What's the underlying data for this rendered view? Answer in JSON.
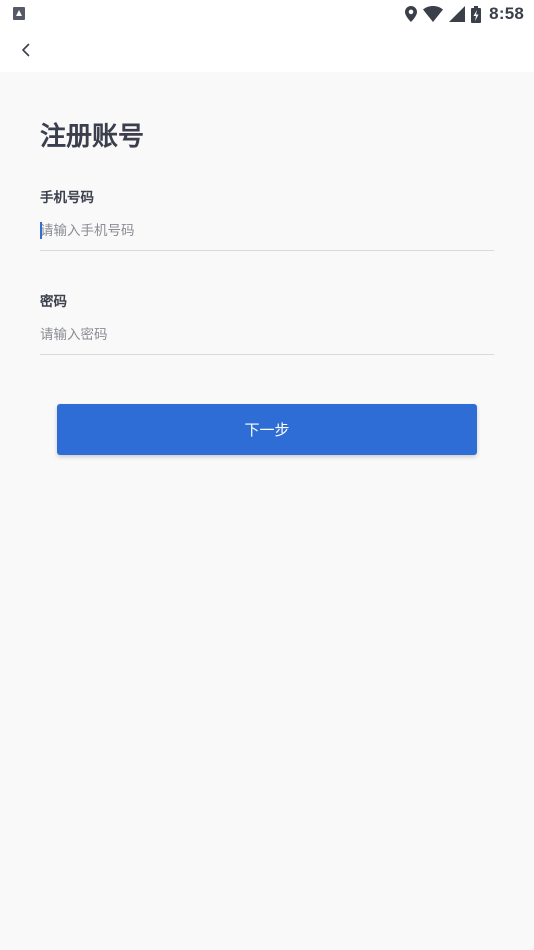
{
  "status_bar": {
    "time": "8:58",
    "icons": [
      "notification-a-icon",
      "location-icon",
      "wifi-icon",
      "signal-icon",
      "battery-charging-icon"
    ]
  },
  "toolbar": {
    "back_icon": "chevron-left-icon"
  },
  "page": {
    "title": "注册账号"
  },
  "form": {
    "phone": {
      "label": "手机号码",
      "placeholder": "请输入手机号码",
      "value": ""
    },
    "password": {
      "label": "密码",
      "placeholder": "请输入密码",
      "value": ""
    },
    "next_label": "下一步"
  },
  "colors": {
    "primary": "#2e6cd6",
    "background": "#f9f9f9",
    "title": "#3b3e4c",
    "placeholder": "#8a8c93",
    "divider": "#d9d9de"
  }
}
